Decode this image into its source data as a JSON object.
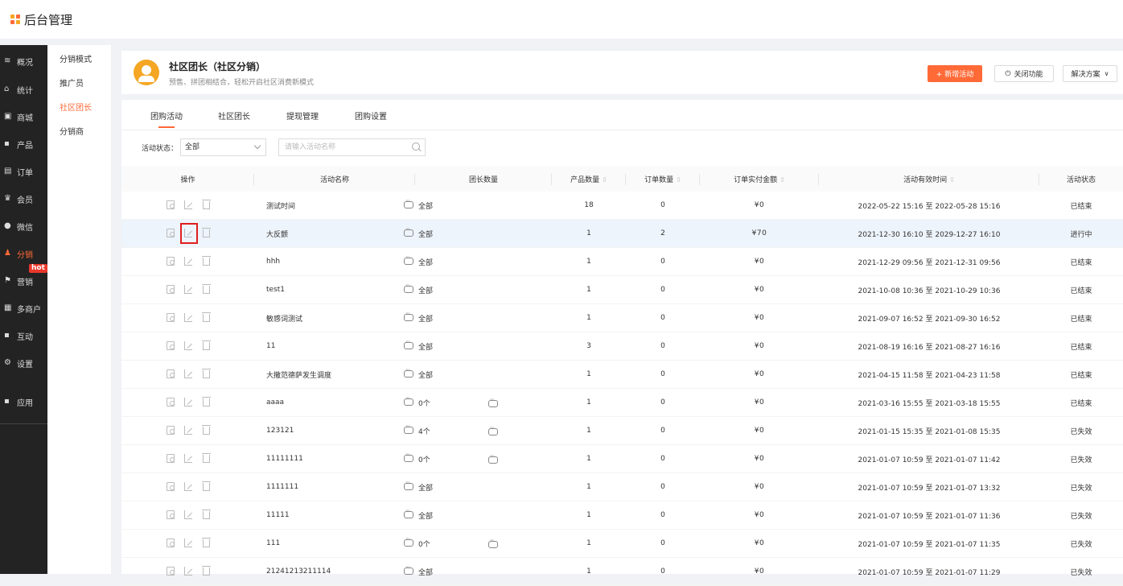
{
  "app": {
    "title": "后台管理"
  },
  "colors": {
    "accent": "#ff6a37",
    "hot": "#e9382b"
  },
  "sidebar": {
    "items": [
      {
        "label": "概况",
        "icon": "dashboard-icon"
      },
      {
        "label": "统计",
        "icon": "chart-icon"
      },
      {
        "label": "商城",
        "icon": "shop-icon"
      },
      {
        "label": "产品",
        "icon": "grid-icon"
      },
      {
        "label": "订单",
        "icon": "order-icon"
      },
      {
        "label": "会员",
        "icon": "crown-icon"
      },
      {
        "label": "微信",
        "icon": "wechat-icon"
      },
      {
        "label": "分销",
        "icon": "users-icon",
        "active": true
      },
      {
        "label": "营销",
        "icon": "flag-icon"
      },
      {
        "label": "多商户",
        "icon": "store-icon"
      },
      {
        "label": "互动",
        "icon": "grid-icon"
      },
      {
        "label": "设置",
        "icon": "gear-icon"
      },
      {
        "label": "应用",
        "icon": "apps-icon"
      }
    ],
    "hot_badge": "hot"
  },
  "subnav": {
    "items": [
      {
        "label": "分销模式"
      },
      {
        "label": "推广员"
      },
      {
        "label": "社区团长",
        "active": true
      },
      {
        "label": "分销商"
      }
    ]
  },
  "header": {
    "title": "社区团长（社区分销）",
    "subtitle": "预售、拼团相结合，轻松开启社区消费新模式",
    "add_button": "+ 新增活动",
    "close_button": "关闭功能",
    "solution_button": "解决方案"
  },
  "tabs": [
    {
      "label": "团购活动",
      "active": true
    },
    {
      "label": "社区团长"
    },
    {
      "label": "提现管理"
    },
    {
      "label": "团购设置"
    }
  ],
  "filter": {
    "status_label": "活动状态：",
    "status_value": "全部",
    "search_placeholder": "请输入活动名称"
  },
  "table": {
    "columns": [
      "操作",
      "活动名称",
      "团长数量",
      "产品数量",
      "订单数量",
      "订单实付金额",
      "活动有效时间",
      "活动状态"
    ],
    "rows": [
      {
        "name": "测试时间",
        "leader": "全部",
        "leader2": false,
        "products": "18",
        "orders": "0",
        "amount": "¥0",
        "time": "2022-05-22 15:16 至 2022-05-28 15:16",
        "status": "已结束"
      },
      {
        "name": "大反颤",
        "leader": "全部",
        "leader2": false,
        "products": "1",
        "orders": "2",
        "amount": "¥70",
        "time": "2021-12-30 16:10 至 2029-12-27 16:10",
        "status": "进行中"
      },
      {
        "name": "hhh",
        "leader": "全部",
        "leader2": false,
        "products": "1",
        "orders": "0",
        "amount": "¥0",
        "time": "2021-12-29 09:56 至 2021-12-31 09:56",
        "status": "已结束"
      },
      {
        "name": "test1",
        "leader": "全部",
        "leader2": false,
        "products": "1",
        "orders": "0",
        "amount": "¥0",
        "time": "2021-10-08 10:36 至 2021-10-29 10:36",
        "status": "已结束"
      },
      {
        "name": "敏感词测试",
        "leader": "全部",
        "leader2": false,
        "products": "1",
        "orders": "0",
        "amount": "¥0",
        "time": "2021-09-07 16:52 至 2021-09-30 16:52",
        "status": "已结束"
      },
      {
        "name": "11",
        "leader": "全部",
        "leader2": false,
        "products": "3",
        "orders": "0",
        "amount": "¥0",
        "time": "2021-08-19 16:16 至 2021-08-27 16:16",
        "status": "已结束"
      },
      {
        "name": "大撒范德萨发生调度",
        "leader": "全部",
        "leader2": false,
        "products": "1",
        "orders": "0",
        "amount": "¥0",
        "time": "2021-04-15 11:58 至 2021-04-23 11:58",
        "status": "已结束"
      },
      {
        "name": "aaaa",
        "leader": "0个",
        "leader2": true,
        "products": "1",
        "orders": "0",
        "amount": "¥0",
        "time": "2021-03-16 15:55 至 2021-03-18 15:55",
        "status": "已结束"
      },
      {
        "name": "123121",
        "leader": "4个",
        "leader2": true,
        "products": "1",
        "orders": "0",
        "amount": "¥0",
        "time": "2021-01-15 15:35 至 2021-01-08 15:35",
        "status": "已失效"
      },
      {
        "name": "11111111",
        "leader": "0个",
        "leader2": true,
        "products": "1",
        "orders": "0",
        "amount": "¥0",
        "time": "2021-01-07 10:59 至 2021-01-07 11:42",
        "status": "已失效"
      },
      {
        "name": "1111111",
        "leader": "全部",
        "leader2": false,
        "products": "1",
        "orders": "0",
        "amount": "¥0",
        "time": "2021-01-07 10:59 至 2021-01-07 13:32",
        "status": "已失效"
      },
      {
        "name": "11111",
        "leader": "全部",
        "leader2": false,
        "products": "1",
        "orders": "0",
        "amount": "¥0",
        "time": "2021-01-07 10:59 至 2021-01-07 11:36",
        "status": "已失效"
      },
      {
        "name": "111",
        "leader": "0个",
        "leader2": true,
        "products": "1",
        "orders": "0",
        "amount": "¥0",
        "time": "2021-01-07 10:59 至 2021-01-07 11:35",
        "status": "已失效"
      },
      {
        "name": "21241213211114",
        "leader": "全部",
        "leader2": false,
        "products": "1",
        "orders": "0",
        "amount": "¥0",
        "time": "2021-01-07 10:59 至 2021-01-07 11:29",
        "status": "已失效"
      }
    ]
  }
}
